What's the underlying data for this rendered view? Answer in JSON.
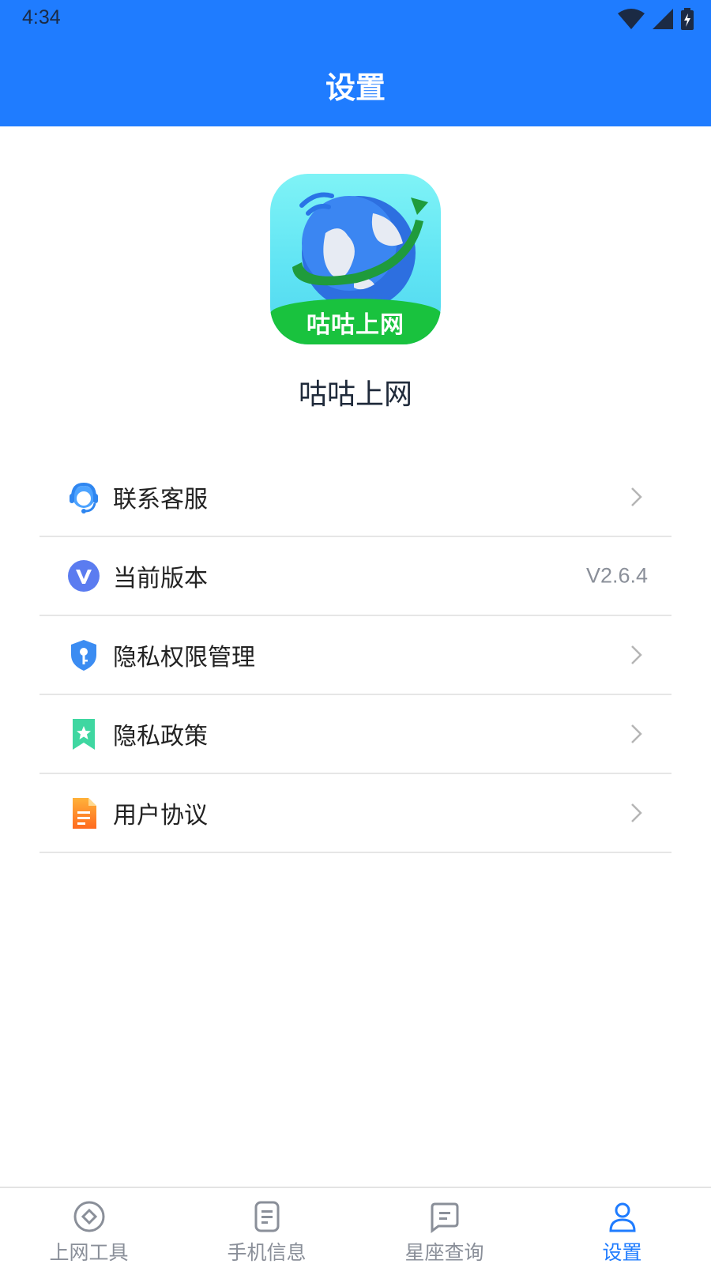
{
  "status_bar": {
    "time": "4:34"
  },
  "header": {
    "title": "设置"
  },
  "app": {
    "logo_text": "咕咕上网",
    "name": "咕咕上网"
  },
  "menu": {
    "items": [
      {
        "label": "联系客服",
        "icon": "headset-icon",
        "chevron": true
      },
      {
        "label": "当前版本",
        "icon": "version-icon",
        "value": "V2.6.4"
      },
      {
        "label": "隐私权限管理",
        "icon": "shield-key-icon",
        "chevron": true
      },
      {
        "label": "隐私政策",
        "icon": "bookmark-star-icon",
        "chevron": true
      },
      {
        "label": "用户协议",
        "icon": "document-icon",
        "chevron": true
      }
    ]
  },
  "tabbar": {
    "tabs": [
      {
        "label": "上网工具",
        "icon": "compass-icon",
        "active": false
      },
      {
        "label": "手机信息",
        "icon": "note-icon",
        "active": false
      },
      {
        "label": "星座查询",
        "icon": "chat-note-icon",
        "active": false
      },
      {
        "label": "设置",
        "icon": "user-icon",
        "active": true
      }
    ]
  },
  "colors": {
    "primary": "#1f7cff",
    "header_bg": "#1f7cff",
    "inactive_tab": "#8a8f99",
    "divider": "#e6e6e6"
  }
}
